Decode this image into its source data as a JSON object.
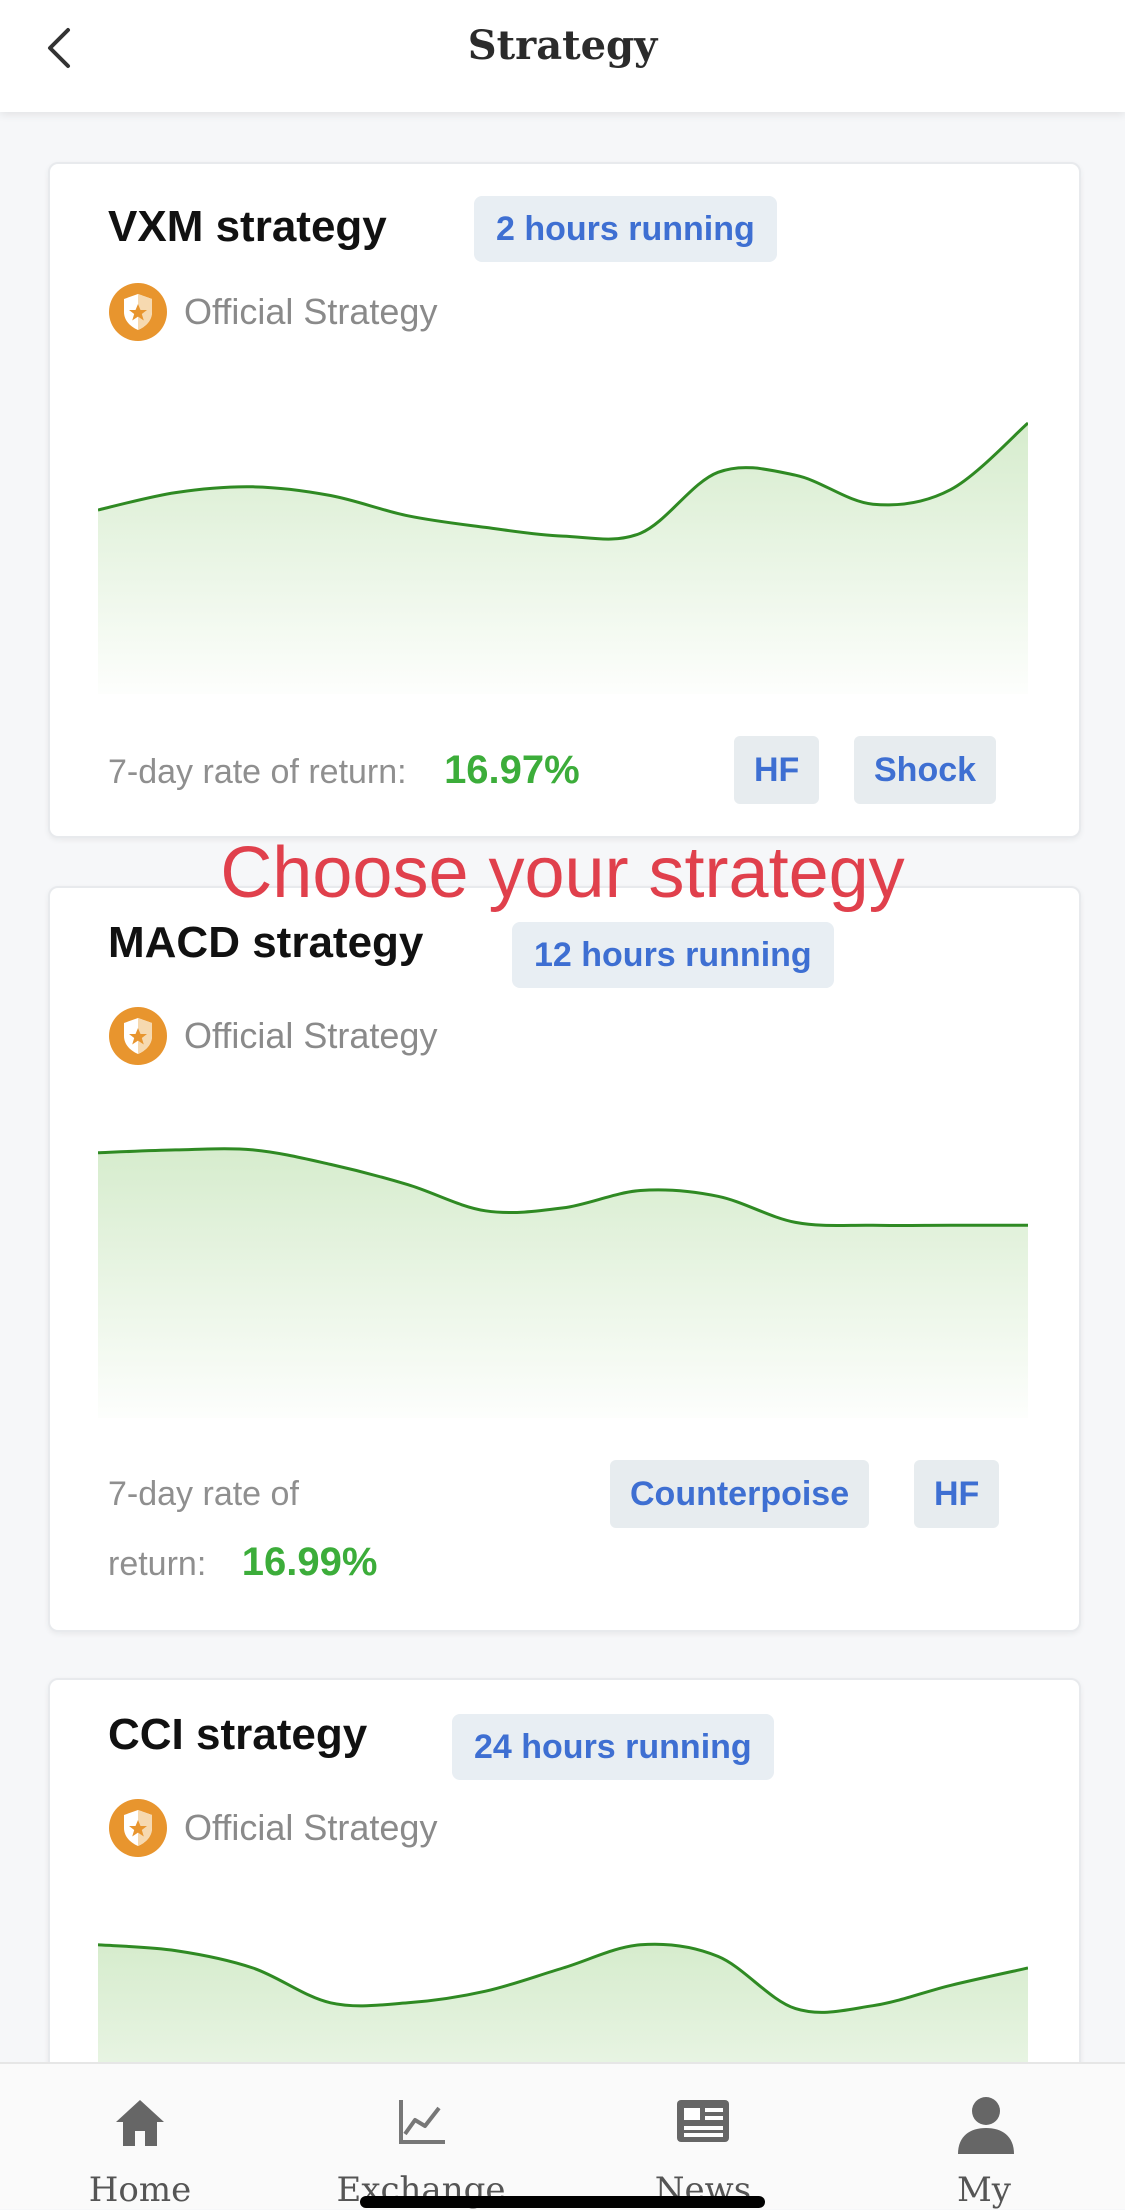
{
  "header": {
    "title": "Strategy"
  },
  "overlay": {
    "text": "Choose your strategy"
  },
  "strategies": [
    {
      "name": "VXM strategy",
      "running": "2 hours running",
      "official": "Official Strategy",
      "return_label": "7-day rate of return:",
      "return_value": "16.97%",
      "tags": [
        "HF",
        "Shock"
      ],
      "chart_data": {
        "type": "area",
        "x": [
          0,
          1,
          2,
          3,
          4,
          5,
          6,
          7,
          8,
          9,
          10,
          11,
          12
        ],
        "values": [
          60,
          66,
          68,
          65,
          58,
          54,
          51,
          52,
          73,
          72,
          62,
          67,
          90
        ],
        "ylim": [
          0,
          100
        ],
        "color": "#2f8a23",
        "fill": "#d6eccd"
      }
    },
    {
      "name": "MACD strategy",
      "running": "12 hours running",
      "official": "Official Strategy",
      "return_label_line1": "7-day rate of",
      "return_label_line2": "return:",
      "return_value": "16.99%",
      "tags": [
        "Counterpoise",
        "HF"
      ],
      "chart_data": {
        "type": "area",
        "x": [
          0,
          1,
          2,
          3,
          4,
          5,
          6,
          7,
          8,
          9,
          10,
          11,
          12
        ],
        "values": [
          88,
          89,
          89,
          84,
          77,
          68,
          69,
          75,
          73,
          64,
          63,
          63,
          63
        ],
        "ylim": [
          0,
          100
        ],
        "color": "#2f8a23",
        "fill": "#d6eccd"
      }
    },
    {
      "name": "CCI strategy",
      "running": "24 hours running",
      "official": "Official Strategy",
      "chart_data": {
        "type": "area",
        "x": [
          0,
          1,
          2,
          3,
          4,
          5,
          6,
          7,
          8,
          9,
          10,
          11,
          12
        ],
        "values": [
          88,
          86,
          80,
          68,
          68,
          72,
          80,
          88,
          84,
          66,
          67,
          74,
          80
        ],
        "ylim": [
          0,
          100
        ],
        "color": "#2f8a23",
        "fill": "#d6eccd"
      }
    }
  ],
  "tabbar": {
    "items": [
      {
        "label": "Home",
        "icon": "home-icon"
      },
      {
        "label": "Exchange",
        "icon": "chart-line-icon"
      },
      {
        "label": "News",
        "icon": "newspaper-icon"
      },
      {
        "label": "My",
        "icon": "user-icon"
      }
    ]
  }
}
